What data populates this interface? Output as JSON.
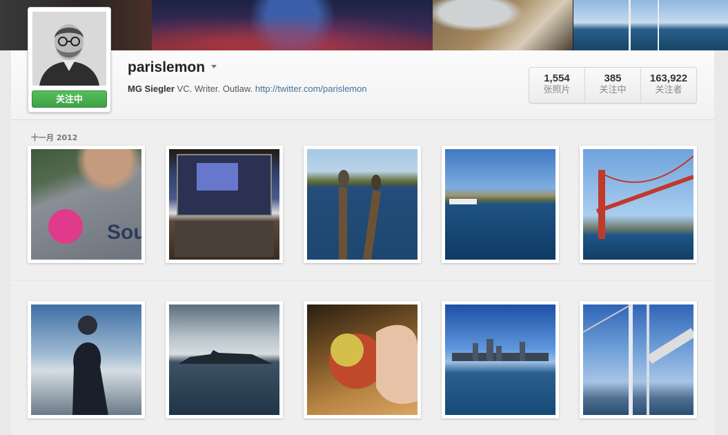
{
  "banner": {
    "tiles": [
      {
        "name": "banner-photo-left",
        "icon": "photo-icon"
      },
      {
        "name": "banner-photo-concert",
        "icon": "photo-icon"
      },
      {
        "name": "banner-photo-desk",
        "icon": "photo-icon"
      },
      {
        "name": "banner-photo-sailboat",
        "icon": "photo-icon"
      }
    ]
  },
  "profile": {
    "username": "parislemon",
    "follow_label": "关注中",
    "bio_name": "MG Siegler",
    "bio_text": "VC. Writer. Outlaw.",
    "bio_link": "http://twitter.com/parislemon",
    "colors": {
      "follow_button": "#3ea247",
      "link": "#3f729b"
    }
  },
  "stats": [
    {
      "value": "1,554",
      "label": "张照片"
    },
    {
      "value": "385",
      "label": "关注中"
    },
    {
      "value": "163,922",
      "label": "关注者"
    }
  ],
  "feed": {
    "month_label": "十一月 2012",
    "rows": [
      [
        {
          "alt": "I Voted sticker on shirt"
        },
        {
          "alt": "Laptop screen"
        },
        {
          "alt": "Pelicans on pilings"
        },
        {
          "alt": "Boats in bay"
        },
        {
          "alt": "Golden Gate Bridge"
        }
      ],
      [
        {
          "alt": "Silhouette on boat"
        },
        {
          "alt": "Alcatraz island"
        },
        {
          "alt": "Apple in hand"
        },
        {
          "alt": "City skyline from water"
        },
        {
          "alt": "Sailboat mast"
        }
      ]
    ]
  }
}
